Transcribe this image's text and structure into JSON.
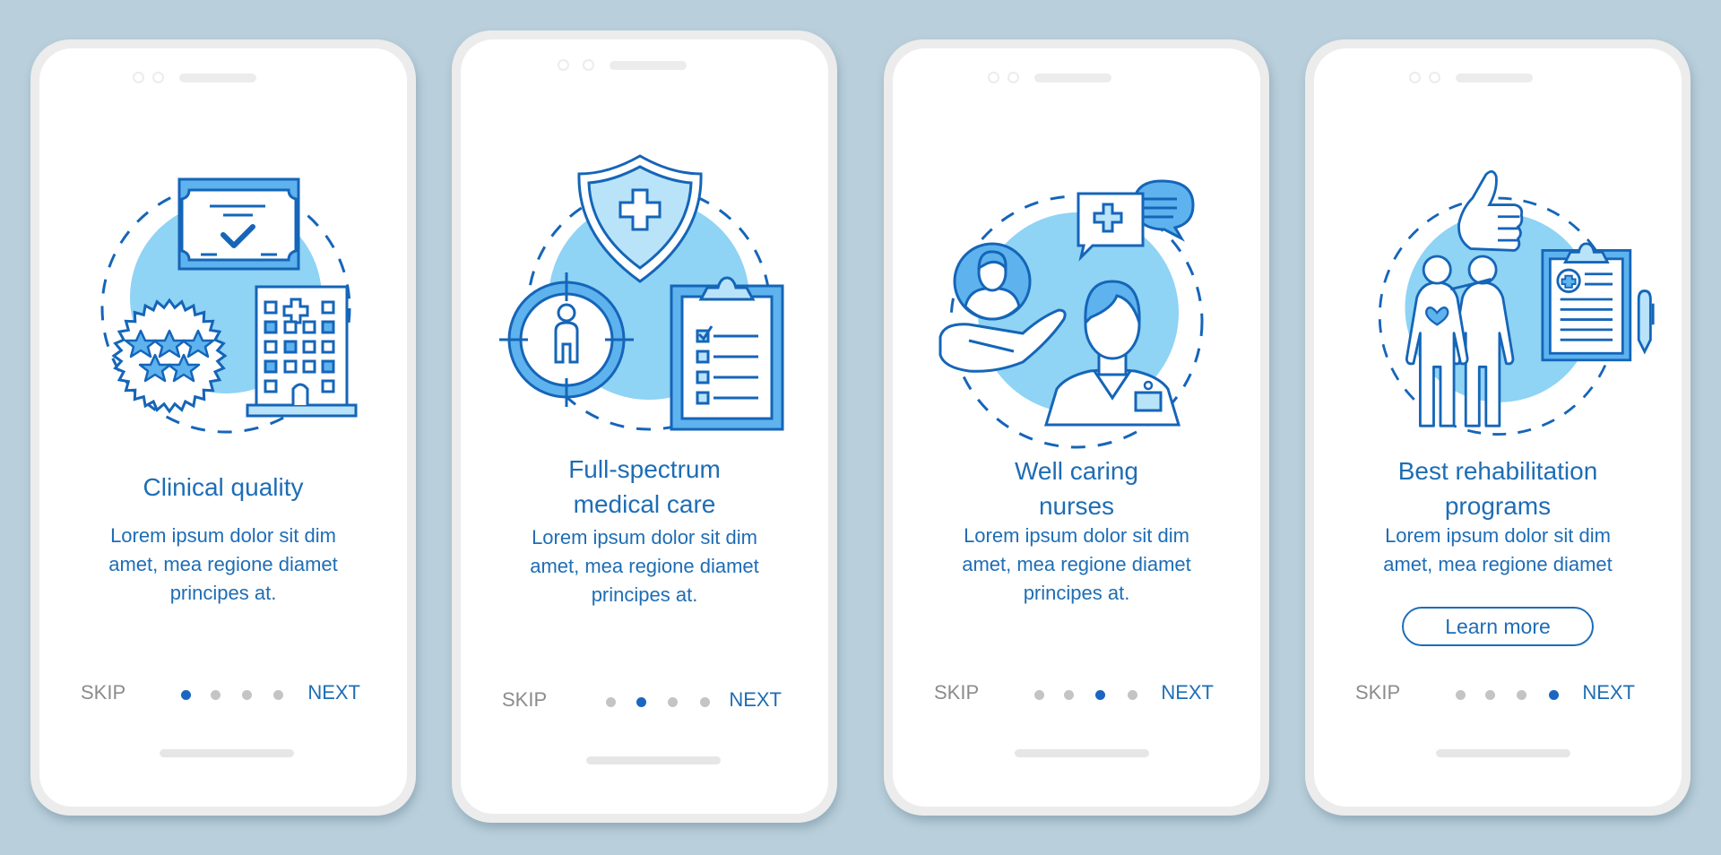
{
  "colors": {
    "background": "#b9cfdb",
    "accent": "#1e6db5",
    "active_dot": "#1a66c0",
    "inactive_dot": "#c4c4c4",
    "skip_text": "#8c8c8c",
    "illustration_fill": "#8fd3f5",
    "illustration_fill_mid": "#5eb3ee",
    "illustration_stroke": "#1565b8"
  },
  "screens": [
    {
      "illustration": "certificate-stars-hospital-icon",
      "title_lines": [
        "Clinical quality"
      ],
      "body_lines": [
        "Lorem ipsum dolor sit dim",
        "amet, mea regione diamet",
        "principes at."
      ],
      "skip_label": "SKIP",
      "next_label": "NEXT",
      "page_index": 1,
      "page_count": 4
    },
    {
      "illustration": "shield-target-clipboard-icon",
      "title_lines": [
        "Full-spectrum",
        "medical care"
      ],
      "body_lines": [
        "Lorem ipsum dolor sit dim",
        "amet, mea regione diamet",
        "principes at."
      ],
      "skip_label": "SKIP",
      "next_label": "NEXT",
      "page_index": 2,
      "page_count": 4
    },
    {
      "illustration": "nurse-patient-chat-icon",
      "title_lines": [
        "Well caring",
        "nurses"
      ],
      "body_lines": [
        "Lorem ipsum dolor sit dim",
        "amet, mea regione diamet",
        "principes at."
      ],
      "skip_label": "SKIP",
      "next_label": "NEXT",
      "page_index": 3,
      "page_count": 4
    },
    {
      "illustration": "rehabilitation-thumbs-up-icon",
      "title_lines": [
        "Best rehabilitation",
        "programs"
      ],
      "body_lines": [
        "Lorem ipsum dolor sit dim",
        "amet, mea regione diamet"
      ],
      "button_label": "Learn more",
      "skip_label": "SKIP",
      "next_label": "NEXT",
      "page_index": 4,
      "page_count": 4
    }
  ]
}
